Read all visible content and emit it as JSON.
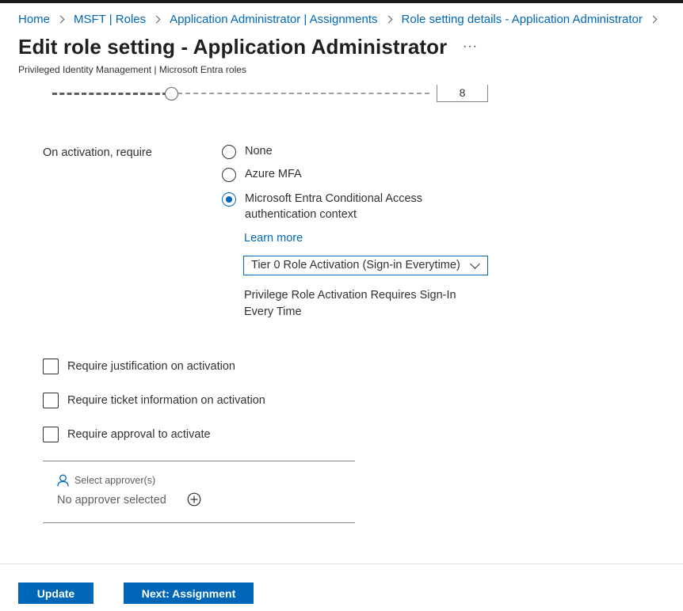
{
  "breadcrumb": {
    "items": [
      "Home",
      "MSFT | Roles",
      "Application Administrator | Assignments",
      "Role setting details - Application Administrator"
    ]
  },
  "header": {
    "title": "Edit role setting - Application Administrator",
    "more_label": "···",
    "subtitle": "Privileged Identity Management | Microsoft Entra roles"
  },
  "duration": {
    "value": "8",
    "slider_fraction": 0.31
  },
  "activation": {
    "label": "On activation, require",
    "options": [
      {
        "label": "None",
        "selected": false
      },
      {
        "label": "Azure MFA",
        "selected": false
      },
      {
        "label": "Microsoft Entra Conditional Access authentication context",
        "selected": true
      }
    ],
    "learn_more": "Learn more",
    "context_selected": "Tier 0 Role Activation (Sign-in Everytime)",
    "context_description": "Privilege Role Activation Requires Sign-In Every Time"
  },
  "requirements": {
    "justification": "Require justification on activation",
    "ticket": "Require ticket information on activation",
    "approval": "Require approval to activate"
  },
  "approvers": {
    "label": "Select approver(s)",
    "empty": "No approver selected"
  },
  "footer": {
    "update_label": "Update",
    "next_label": "Next: Assignment"
  },
  "colors": {
    "accent": "#0067b8",
    "text": "#323130"
  },
  "icons": [
    "chevron-right-icon",
    "more-icon",
    "person-icon",
    "add-circle-icon",
    "chevron-down-icon"
  ]
}
